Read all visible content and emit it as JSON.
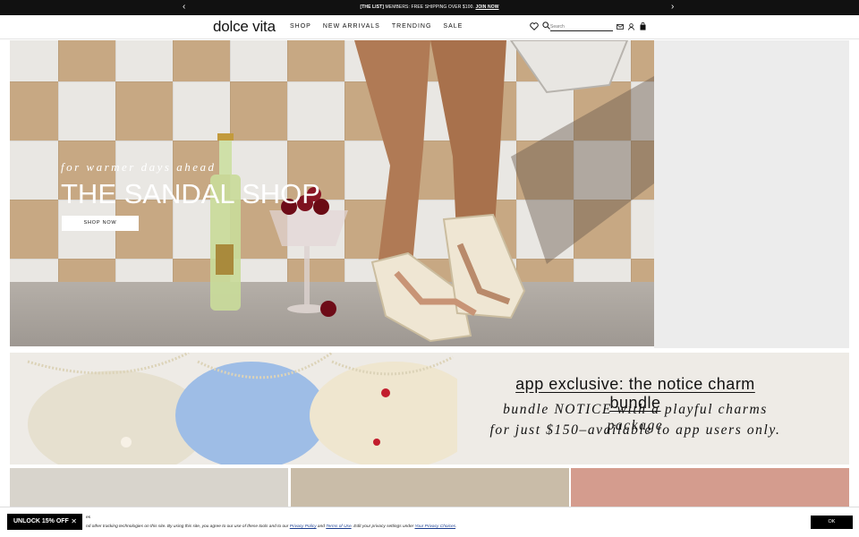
{
  "announcement": {
    "tag": "[THE LIST]",
    "text": " MEMBERS: FREE SHIPPING OVER $100. ",
    "link": "JOIN NOW",
    "prev_icon": "chevron-left-icon",
    "next_icon": "chevron-right-icon"
  },
  "header": {
    "logo": "dolce vita",
    "nav": [
      "SHOP",
      "NEW ARRIVALS",
      "TRENDING",
      "SALE"
    ],
    "search_placeholder": "Search",
    "icons": [
      "heart-icon",
      "search-icon",
      "mail-icon",
      "account-icon",
      "bag-icon"
    ]
  },
  "hero": {
    "subtitle": "for warmer days ahead",
    "title": "THE SANDAL SHOP",
    "button": "SHOP NOW"
  },
  "promo": {
    "title": "app exclusive: the notice charm bundle",
    "line1": "bundle NOTICE with a playful charms package",
    "line2": "for just $150–available to app users only."
  },
  "cookie": {
    "heading": "es",
    "text_start": "nd other tracking technologies on this site. By using this site, you agree to our use of these tools and to our ",
    "privacy_link": "Privacy Policy",
    "and": " and ",
    "terms_link": "Terms of Use",
    "text_mid": ". Edit your privacy settings under ",
    "choices_link": "Your Privacy Choices",
    "text_end": ".",
    "ok": "OK"
  },
  "unlock": {
    "label": "UNLOCK 15% OFF",
    "close_icon": "close-icon"
  },
  "colors": {
    "announcement_bg": "#111111",
    "tile_white": "#e9e7e3",
    "tile_tan": "#c7a883",
    "promo_bg": "#eeebe6",
    "cookie_link": "#1a3d8f"
  }
}
